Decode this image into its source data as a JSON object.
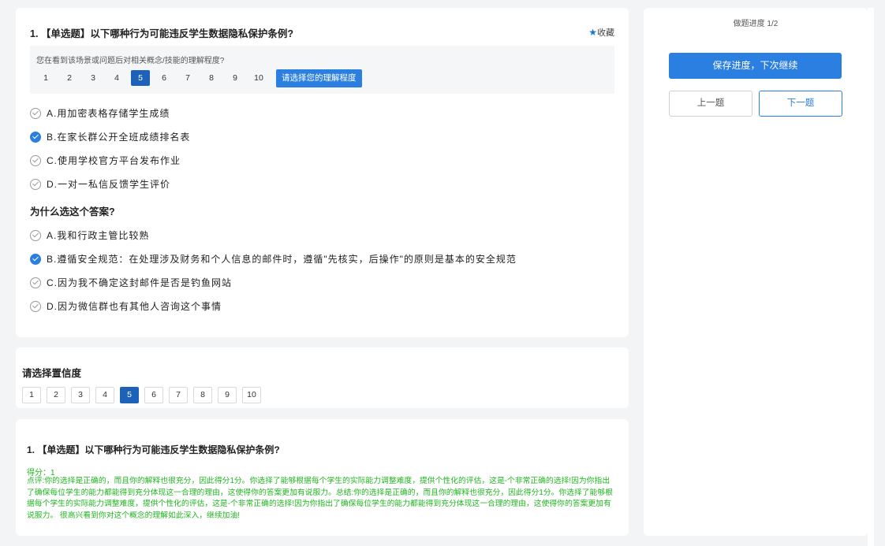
{
  "question": {
    "title": "1. 【单选题】以下哪种行为可能违反学生数据隐私保护条例?",
    "favorite_label": "收藏",
    "understanding": {
      "label": "您在看到该场景或问题后对相关概念/技能的理解程度?",
      "scale": [
        "1",
        "2",
        "3",
        "4",
        "5",
        "6",
        "7",
        "8",
        "9",
        "10"
      ],
      "selected": "5",
      "prompt_button": "请选择您的理解程度"
    },
    "options": [
      {
        "text": "A.用加密表格存储学生成绩",
        "checked": false
      },
      {
        "text": "B.在家长群公开全班成绩排名表",
        "checked": true
      },
      {
        "text": "C.使用学校官方平台发布作业",
        "checked": false
      },
      {
        "text": "D.一对一私信反馈学生评价",
        "checked": false
      }
    ],
    "why_title": "为什么选这个答案?",
    "reasons": [
      {
        "text": "A.我和行政主管比较熟",
        "checked": false
      },
      {
        "text": "B.遵循安全规范：在处理涉及财务和个人信息的邮件时，遵循\"先核实，后操作\"的原则是基本的安全规范",
        "checked": true
      },
      {
        "text": "C.因为我不确定这封邮件是否是钓鱼网站",
        "checked": false
      },
      {
        "text": "D.因为微信群也有其他人咨询这个事情",
        "checked": false
      }
    ]
  },
  "confidence": {
    "title": "请选择置信度",
    "scale": [
      "1",
      "2",
      "3",
      "4",
      "5",
      "6",
      "7",
      "8",
      "9",
      "10"
    ],
    "selected": "5"
  },
  "result": {
    "title": "1. 【单选题】以下哪种行为可能违反学生数据隐私保护条例?",
    "score": "得分：1",
    "comment": "点评:你的选择是正确的，而且你的解释也很充分，因此得分1分。你选择了能够根据每个学生的实际能力调整难度，提供个性化的评估，这是-个非常正确的选择!因为你指出了确保每位学生的能力都能得到充分体现这一合理的理由，这使得你的答案更加有说服力。总结:你的选择是正确的，而且你的解释也很充分，因此得分1分。你选择了能够根据每个学生的实际能力调整难度，提供个性化的评估，这是-个非常正确的选择!因为你指出了确保每位学生的能力都能得到充分体现这一合理的理由，这使得你的答案更加有说服力。 很高兴看到你对这个概念的理解如此深入，继续加油!"
  },
  "sidebar": {
    "progress": "做题进度 1/2",
    "save_button": "保存进度，下次继续",
    "prev_button": "上一题",
    "next_button": "下一题"
  },
  "colors": {
    "accent": "#2a7fe0",
    "selected_scale": "#1d62b8",
    "feedback_green": "#22b522"
  }
}
